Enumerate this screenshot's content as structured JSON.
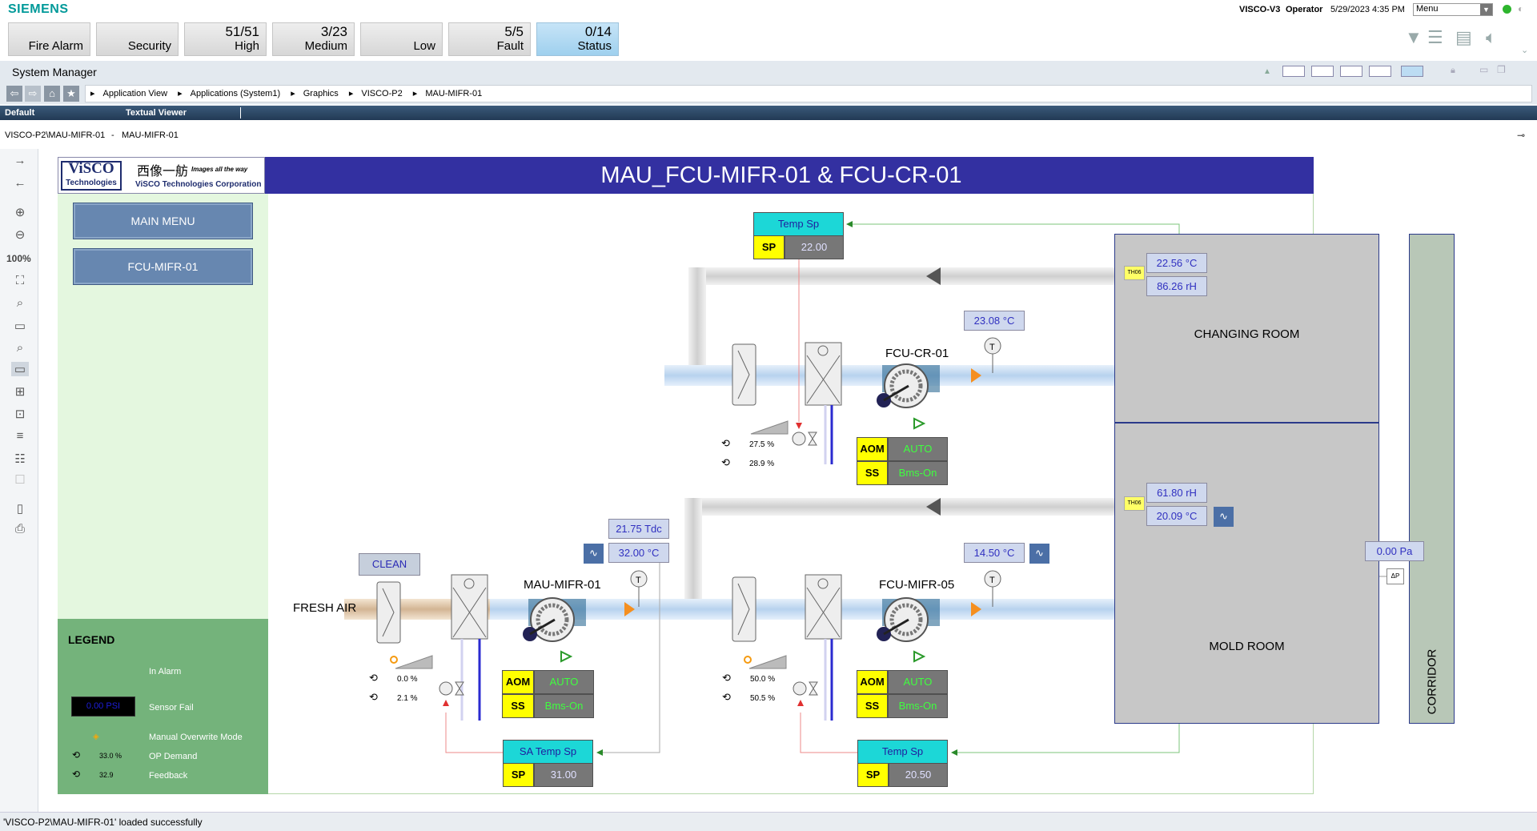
{
  "app": {
    "brand": "SIEMENS",
    "project": "VISCO-V3",
    "user": "Operator",
    "datetime": "5/29/2023  4:35 PM",
    "menu_label": "Menu"
  },
  "summary": [
    {
      "count": "",
      "label": "Fire Alarm"
    },
    {
      "count": "",
      "label": "Security"
    },
    {
      "count": "51/51",
      "label": "High"
    },
    {
      "count": "3/23",
      "label": "Medium"
    },
    {
      "count": "",
      "label": "Low"
    },
    {
      "count": "5/5",
      "label": "Fault"
    },
    {
      "count": "0/14",
      "label": "Status"
    }
  ],
  "system_manager": {
    "title": "System Manager"
  },
  "breadcrumb": [
    "Application View",
    "Applications (System1)",
    "Graphics",
    "VISCO-P2",
    "MAU-MIFR-01"
  ],
  "tabs": [
    "Default",
    "Textual Viewer"
  ],
  "path": {
    "left": "VISCO-P2\\MAU-MIFR-01",
    "sep": "-",
    "right": "MAU-MIFR-01"
  },
  "zoom": "100%",
  "graphic": {
    "title": "MAU_FCU-MIFR-01 & FCU-CR-01",
    "logo": {
      "brand": "ViSCO",
      "sub": "Technologies",
      "chinese": "西像一舫",
      "tagline": "Images all the way",
      "corp": "ViSCO Technologies Corporation"
    },
    "menu_buttons": [
      "MAIN MENU",
      "FCU-MIFR-01"
    ],
    "legend": {
      "title": "LEGEND",
      "in_alarm": "In Alarm",
      "sensor_value": "0.00 PSI",
      "sensor_fail": "Sensor Fail",
      "manual": "Manual Overwrite Mode",
      "op_value": "33.0 %",
      "op_demand": "OP Demand",
      "fb_value": "32.9",
      "feedback": "Feedback"
    },
    "fresh_air": "FRESH AIR",
    "clean": "CLEAN",
    "rooms": {
      "changing": "CHANGING ROOM",
      "mold": "MOLD ROOM",
      "corridor": "CORRIDOR"
    },
    "units": {
      "fcu_cr": "FCU-CR-01",
      "mau": "MAU-MIFR-01",
      "fcu_mifr": "FCU-MIFR-05"
    },
    "sensors": {
      "changing_temp": "22.56 °C",
      "changing_rh": "86.26 rH",
      "mold_rh": "61.80 rH",
      "mold_temp": "20.09 °C",
      "cr_supply_temp": "23.08 °C",
      "mau_tdc": "21.75 Tdc",
      "mau_supply_temp": "32.00 °C",
      "mifr_supply_temp": "14.50 °C",
      "corridor_pa": "0.00 Pa",
      "th_tag": "TH06"
    },
    "valves": {
      "cr_op": "27.5 %",
      "cr_fb": "28.9 %",
      "mau_op": "0.0 %",
      "mau_fb": "2.1 %",
      "mifr_op": "50.0 %",
      "mifr_fb": "50.5 %"
    },
    "controls": {
      "aom": "AOM",
      "auto": "AUTO",
      "ss": "SS",
      "bms_on": "Bms-On",
      "sp": "SP",
      "cr_sp_label": "Temp Sp",
      "cr_sp": "22.00",
      "mau_sp_label": "SA Temp Sp",
      "mau_sp": "31.00",
      "mifr_sp_label": "Temp Sp",
      "mifr_sp": "20.50"
    }
  },
  "status": "'VISCO-P2\\MAU-MIFR-01' loaded successfully",
  "colors": {
    "title_bar": "#3330a1",
    "menu_panel": "#e4f7df",
    "legend_bg": "#74b37b",
    "room": "#c7c7c7",
    "pipe": "#bcd6ef"
  }
}
